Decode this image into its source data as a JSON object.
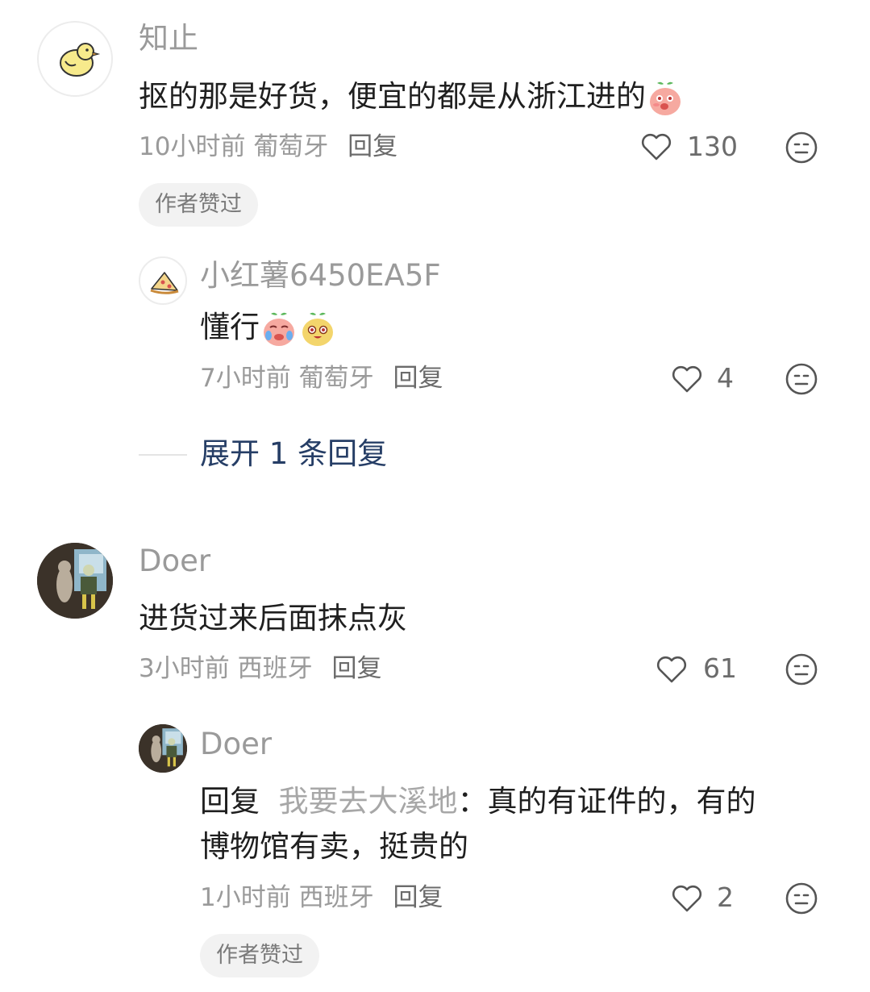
{
  "comments": [
    {
      "username": "知止",
      "text": "抠的那是好货，便宜的都是从浙江进的",
      "time": "10小时前",
      "location": "葡萄牙",
      "reply_label": "回复",
      "likes": "130",
      "badge": "作者赞过",
      "avatar_icon": "chick-icon",
      "trailing_emoji": "pink-peach-blush-emoji",
      "replies": [
        {
          "username": "小红薯6450EA5F",
          "text": "懂行",
          "time": "7小时前",
          "location": "葡萄牙",
          "reply_label": "回复",
          "likes": "4",
          "avatar_icon": "pizza-slice-icon",
          "emojis": [
            "crying-peach-emoji",
            "yellow-peach-emoji"
          ]
        }
      ],
      "expand_label": "展开 1 条回复"
    },
    {
      "username": "Doer",
      "text": "进货过来后面抹点灰",
      "time": "3小时前",
      "location": "西班牙",
      "reply_label": "回复",
      "likes": "61",
      "avatar_icon": "cartoon-characters-avatar",
      "replies": [
        {
          "username": "Doer",
          "reply_prefix": "回复",
          "reply_to": "我要去大溪地",
          "text_line1": "：真的有证件的，有的",
          "text_line2": "博物馆有卖，挺贵的",
          "time": "1小时前",
          "location": "西班牙",
          "reply_label": "回复",
          "likes": "2",
          "badge": "作者赞过",
          "avatar_icon": "cartoon-characters-avatar"
        }
      ]
    }
  ],
  "colors": {
    "username": "#9a9a9a",
    "text": "#1f1f1f",
    "link_blue": "#263e66",
    "badge_bg": "#f2f2f2"
  }
}
